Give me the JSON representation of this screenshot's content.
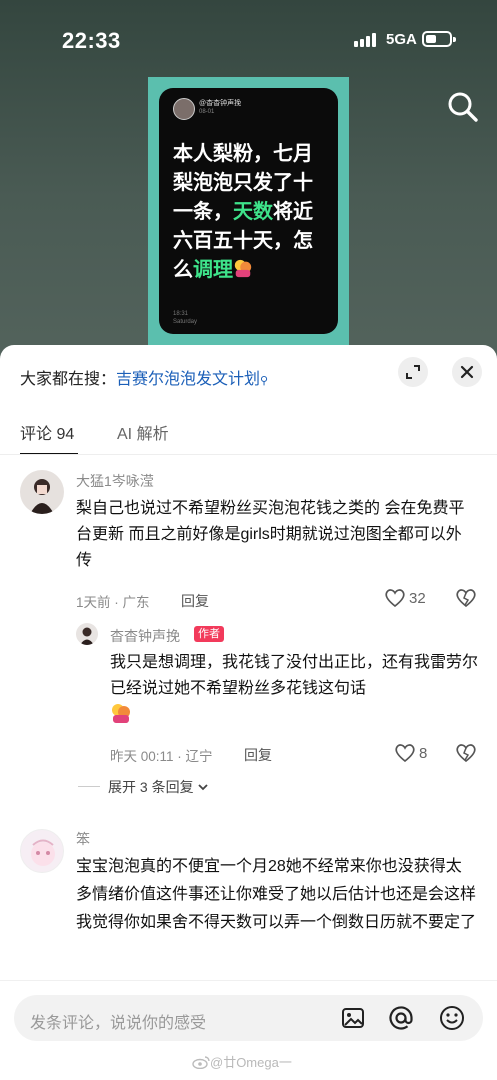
{
  "status_bar": {
    "time": "22:33",
    "network": "5GA"
  },
  "poster": {
    "name": "@杳杳钟声挽",
    "date": "08-01",
    "text_before": "本人梨粉，七月梨泡泡只发了十一条，",
    "text_green1": "天数",
    "text_middle": "将近六百五十天，怎么",
    "text_green2": "调理",
    "footer_time": "18:31",
    "footer_day": "Saturday"
  },
  "hot_search": {
    "prefix": "大家都在搜：",
    "link": "吉赛尔泡泡发文计划"
  },
  "tabs": [
    {
      "label": "评论 94"
    },
    {
      "label": "AI 解析"
    }
  ],
  "comments": [
    {
      "name": "大猛1岑咏滢",
      "text": "梨自己也说过不希望粉丝买泡泡花钱之类的 会在免费平台更新 而且之前好像是girls时期就说过泡图全都可以外传",
      "meta": "1天前 · 广东",
      "reply": "回复",
      "likes": "32"
    },
    {
      "name": "杳杳钟声挽",
      "badge": "作者",
      "text": "我只是想调理，我花钱了没付出正比，还有我雷劳尔已经说过她不希望粉丝多花钱这句话",
      "meta": "昨天 00:11 · 辽宁",
      "reply": "回复",
      "likes": "8"
    },
    {
      "name": "笨",
      "text": "宝宝泡泡真的不便宜一个月28她不经常来你也没获得太多情绪价值这件事还让你难受了她以后估计也还是会这样我觉得你如果舍不得天数可以弄一个倒数日历就不要定了"
    }
  ],
  "expand_replies": "展开 3 条回复",
  "input": {
    "placeholder": "发条评论，说说你的感受"
  },
  "watermark": "@廿Omega一"
}
